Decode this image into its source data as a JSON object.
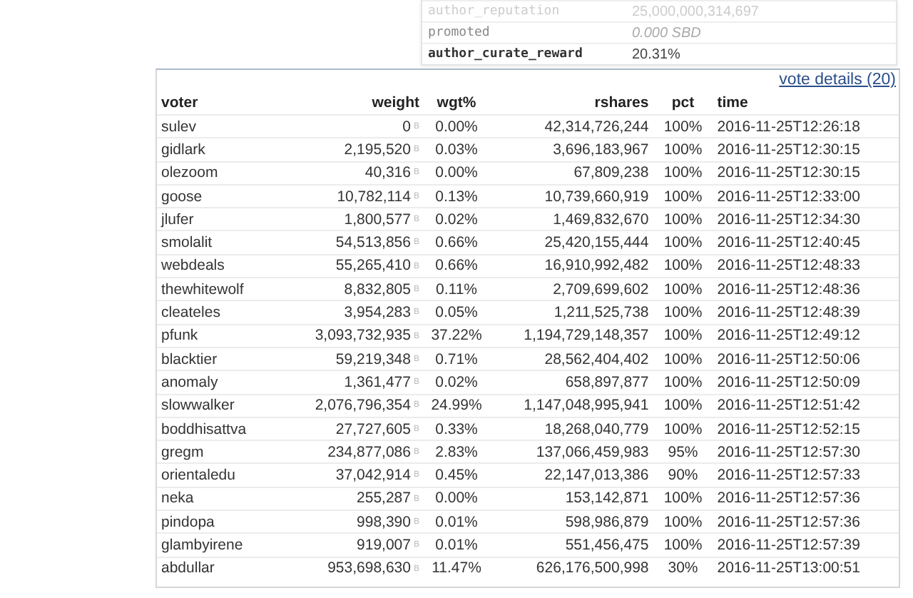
{
  "properties": [
    {
      "key": "author_reputation",
      "value": "25,000,000,314,697",
      "kind": "faded"
    },
    {
      "key": "promoted",
      "value": "0.000 SBD",
      "kind": "muted"
    },
    {
      "key": "author_curate_reward",
      "value": "20.31%",
      "kind": "strong"
    }
  ],
  "vote_details_link": "vote details (20)",
  "votes": {
    "columns": [
      "voter",
      "weight",
      "wgt%",
      "rshares",
      "pct",
      "time"
    ],
    "rows": [
      {
        "voter": "sulev",
        "weight": "0",
        "unit": "B",
        "wgt": "0.00%",
        "rshares": "42,314,726,244",
        "pct": "100%",
        "time": "2016-11-25T12:26:18"
      },
      {
        "voter": "gidlark",
        "weight": "2,195,520",
        "unit": "B",
        "wgt": "0.03%",
        "rshares": "3,696,183,967",
        "pct": "100%",
        "time": "2016-11-25T12:30:15"
      },
      {
        "voter": "olezoom",
        "weight": "40,316",
        "unit": "B",
        "wgt": "0.00%",
        "rshares": "67,809,238",
        "pct": "100%",
        "time": "2016-11-25T12:30:15"
      },
      {
        "voter": "goose",
        "weight": "10,782,114",
        "unit": "B",
        "wgt": "0.13%",
        "rshares": "10,739,660,919",
        "pct": "100%",
        "time": "2016-11-25T12:33:00"
      },
      {
        "voter": "jlufer",
        "weight": "1,800,577",
        "unit": "B",
        "wgt": "0.02%",
        "rshares": "1,469,832,670",
        "pct": "100%",
        "time": "2016-11-25T12:34:30"
      },
      {
        "voter": "smolalit",
        "weight": "54,513,856",
        "unit": "B",
        "wgt": "0.66%",
        "rshares": "25,420,155,444",
        "pct": "100%",
        "time": "2016-11-25T12:40:45"
      },
      {
        "voter": "webdeals",
        "weight": "55,265,410",
        "unit": "B",
        "wgt": "0.66%",
        "rshares": "16,910,992,482",
        "pct": "100%",
        "time": "2016-11-25T12:48:33"
      },
      {
        "voter": "thewhitewolf",
        "weight": "8,832,805",
        "unit": "B",
        "wgt": "0.11%",
        "rshares": "2,709,699,602",
        "pct": "100%",
        "time": "2016-11-25T12:48:36"
      },
      {
        "voter": "cleateles",
        "weight": "3,954,283",
        "unit": "B",
        "wgt": "0.05%",
        "rshares": "1,211,525,738",
        "pct": "100%",
        "time": "2016-11-25T12:48:39"
      },
      {
        "voter": "pfunk",
        "weight": "3,093,732,935",
        "unit": "B",
        "wgt": "37.22%",
        "rshares": "1,194,729,148,357",
        "pct": "100%",
        "time": "2016-11-25T12:49:12"
      },
      {
        "voter": "blacktier",
        "weight": "59,219,348",
        "unit": "B",
        "wgt": "0.71%",
        "rshares": "28,562,404,402",
        "pct": "100%",
        "time": "2016-11-25T12:50:06"
      },
      {
        "voter": "anomaly",
        "weight": "1,361,477",
        "unit": "B",
        "wgt": "0.02%",
        "rshares": "658,897,877",
        "pct": "100%",
        "time": "2016-11-25T12:50:09"
      },
      {
        "voter": "slowwalker",
        "weight": "2,076,796,354",
        "unit": "B",
        "wgt": "24.99%",
        "rshares": "1,147,048,995,941",
        "pct": "100%",
        "time": "2016-11-25T12:51:42"
      },
      {
        "voter": "boddhisattva",
        "weight": "27,727,605",
        "unit": "B",
        "wgt": "0.33%",
        "rshares": "18,268,040,779",
        "pct": "100%",
        "time": "2016-11-25T12:52:15"
      },
      {
        "voter": "gregm",
        "weight": "234,877,086",
        "unit": "B",
        "wgt": "2.83%",
        "rshares": "137,066,459,983",
        "pct": "95%",
        "time": "2016-11-25T12:57:30"
      },
      {
        "voter": "orientaledu",
        "weight": "37,042,914",
        "unit": "B",
        "wgt": "0.45%",
        "rshares": "22,147,013,386",
        "pct": "90%",
        "time": "2016-11-25T12:57:33"
      },
      {
        "voter": "neka",
        "weight": "255,287",
        "unit": "B",
        "wgt": "0.00%",
        "rshares": "153,142,871",
        "pct": "100%",
        "time": "2016-11-25T12:57:36"
      },
      {
        "voter": "pindopa",
        "weight": "998,390",
        "unit": "B",
        "wgt": "0.01%",
        "rshares": "598,986,879",
        "pct": "100%",
        "time": "2016-11-25T12:57:36"
      },
      {
        "voter": "glambyirene",
        "weight": "919,007",
        "unit": "B",
        "wgt": "0.01%",
        "rshares": "551,456,475",
        "pct": "100%",
        "time": "2016-11-25T12:57:39"
      },
      {
        "voter": "abdullar",
        "weight": "953,698,630",
        "unit": "B",
        "wgt": "11.47%",
        "rshares": "626,176,500,998",
        "pct": "30%",
        "time": "2016-11-25T13:00:51"
      }
    ]
  }
}
